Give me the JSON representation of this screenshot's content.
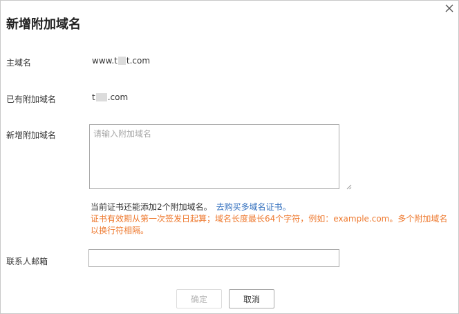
{
  "dialog": {
    "title": "新增附加域名",
    "close_icon": "close-icon"
  },
  "form": {
    "primary_domain_label": "主域名",
    "primary_domain_prefix": "www.t",
    "primary_domain_suffix": "t.com",
    "existing_domains_label": "已有附加域名",
    "existing_domain_prefix": "t",
    "existing_domain_suffix": ".com",
    "new_domains_label": "新增附加域名",
    "new_domains_placeholder": "请输入附加域名",
    "new_domains_value": "",
    "contact_email_label": "联系人邮箱",
    "contact_email_value": ""
  },
  "notes": {
    "quota_text": "当前证书还能添加2个附加域名。",
    "buy_link": "去购买多域名证书。",
    "validity_line1": "证书有效期从第一次签发日起算；域名长度最长64个字符，例如：example.com。多个附加域名",
    "validity_line2": "以换行符相隔。"
  },
  "buttons": {
    "confirm_label": "确定",
    "confirm_disabled": true,
    "cancel_label": "取消"
  },
  "colors": {
    "link": "#2f6dbd",
    "warning": "#ee7a30",
    "border": "#a9a9a9",
    "disabled_text": "#b5b5b5"
  }
}
